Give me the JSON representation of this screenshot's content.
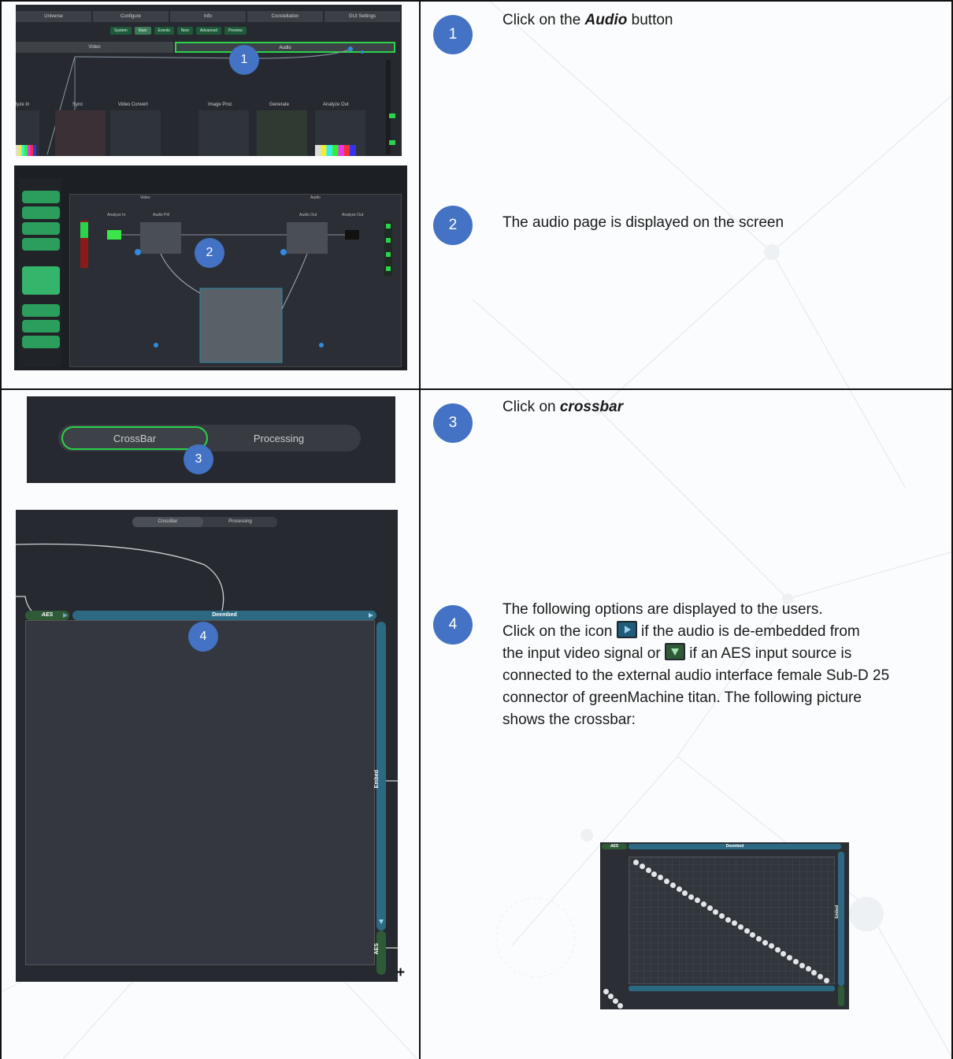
{
  "steps": [
    {
      "num": "1",
      "pre": "Click on the ",
      "bold": "Audio",
      "post": " button"
    },
    {
      "num": "2",
      "text": "The audio page is displayed on the screen"
    },
    {
      "num": "3",
      "pre": "Click on ",
      "bold": "crossbar",
      "post": ""
    },
    {
      "num": "4",
      "line1": "The following options are displayed to the users.",
      "line2a": "Click on the icon ",
      "line2b": " if the audio is de-embedded from",
      "line3a": "the input video signal or ",
      "line3b": " if an AES input source is",
      "line4": "connected to the external audio interface female Sub-D 25",
      "line5": "connector of greenMachine titan. The following picture",
      "line6": "shows the crossbar:"
    }
  ],
  "shot1": {
    "top_tabs": [
      "Universe",
      "Configure",
      "Info",
      "Constellation",
      "GUI Settings"
    ],
    "sub_tabs": [
      "System",
      "Main",
      "Events",
      "Now",
      "Advanced",
      "Preview"
    ],
    "tab_video": "Video",
    "tab_audio": "Audio",
    "callout": "1",
    "labels": [
      "lyze In",
      "Sync",
      "Video Convert",
      "Image Proc",
      "Generate",
      "Analyze Out"
    ]
  },
  "shot2": {
    "callout": "2",
    "labels": [
      "Analyze In",
      "Audio Pill",
      "Audio Out",
      "Analyze Out",
      "Video",
      "Audio"
    ]
  },
  "shot3": {
    "crossbar": "CrossBar",
    "processing": "Processing",
    "callout": "3"
  },
  "shot4": {
    "crossbar": "CrossBar",
    "processing": "Processing",
    "aes": "AES",
    "deembed": "Deembed",
    "embed": "Embed",
    "aes_v": "AES",
    "callout": "4"
  },
  "xb": {
    "aes": "AES",
    "deembed": "Deembed",
    "embed": "Embed"
  },
  "plus": "+",
  "colors": {
    "bubble": "#4472c4",
    "highlight": "#2bd24a",
    "deembed_bar": "#2c6a84",
    "aes_bar": "#2f5a37"
  }
}
